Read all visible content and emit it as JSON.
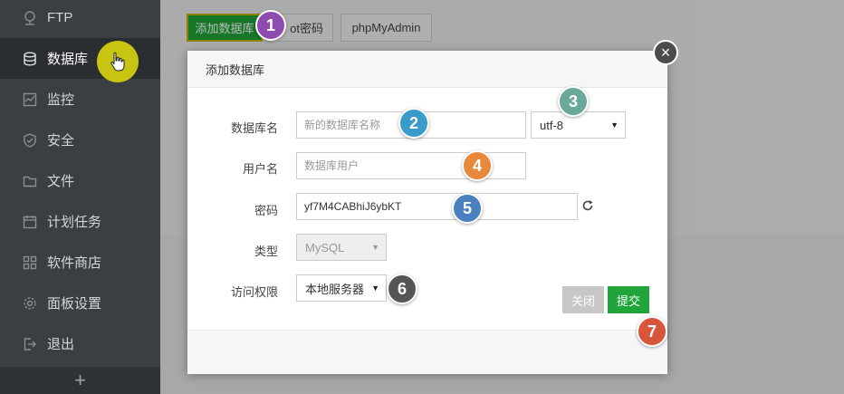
{
  "sidebar": {
    "items": [
      {
        "label": "FTP",
        "icon": "ftp-icon",
        "active": false
      },
      {
        "label": "数据库",
        "icon": "database-icon",
        "active": true
      },
      {
        "label": "监控",
        "icon": "monitor-icon",
        "active": false
      },
      {
        "label": "安全",
        "icon": "shield-icon",
        "active": false
      },
      {
        "label": "文件",
        "icon": "folder-icon",
        "active": false
      },
      {
        "label": "计划任务",
        "icon": "calendar-icon",
        "active": false
      },
      {
        "label": "软件商店",
        "icon": "grid-icon",
        "active": false
      },
      {
        "label": "面板设置",
        "icon": "gear-icon",
        "active": false
      },
      {
        "label": "退出",
        "icon": "logout-icon",
        "active": false
      }
    ],
    "bottom_symbol": "+"
  },
  "toolbar": {
    "add_db_label": "添加数据库",
    "root_pwd_label": "ot密码",
    "phpmyadmin_label": "phpMyAdmin"
  },
  "modal": {
    "title": "添加数据库",
    "close_symbol": "×",
    "db_name_label": "数据库名",
    "db_name_placeholder": "新的数据库名称",
    "charset_value": "utf-8",
    "username_label": "用户名",
    "username_placeholder": "数据库用户",
    "password_label": "密码",
    "password_value": "yf7M4CABhiJ6ybKT",
    "type_label": "类型",
    "type_value": "MySQL",
    "access_label": "访问权限",
    "access_value": "本地服务器",
    "close_button": "关闭",
    "submit_button": "提交"
  },
  "badges": [
    "1",
    "2",
    "3",
    "4",
    "5",
    "6",
    "7"
  ],
  "colors": {
    "green": "#20a53a",
    "badge_purple": "#8e4cb0",
    "badge_blue": "#3a9ac9",
    "badge_teal": "#6aa99a",
    "badge_orange": "#e8883a",
    "badge_steelblue": "#4a7fc0",
    "badge_dark": "#555555",
    "badge_red": "#d9553a"
  }
}
